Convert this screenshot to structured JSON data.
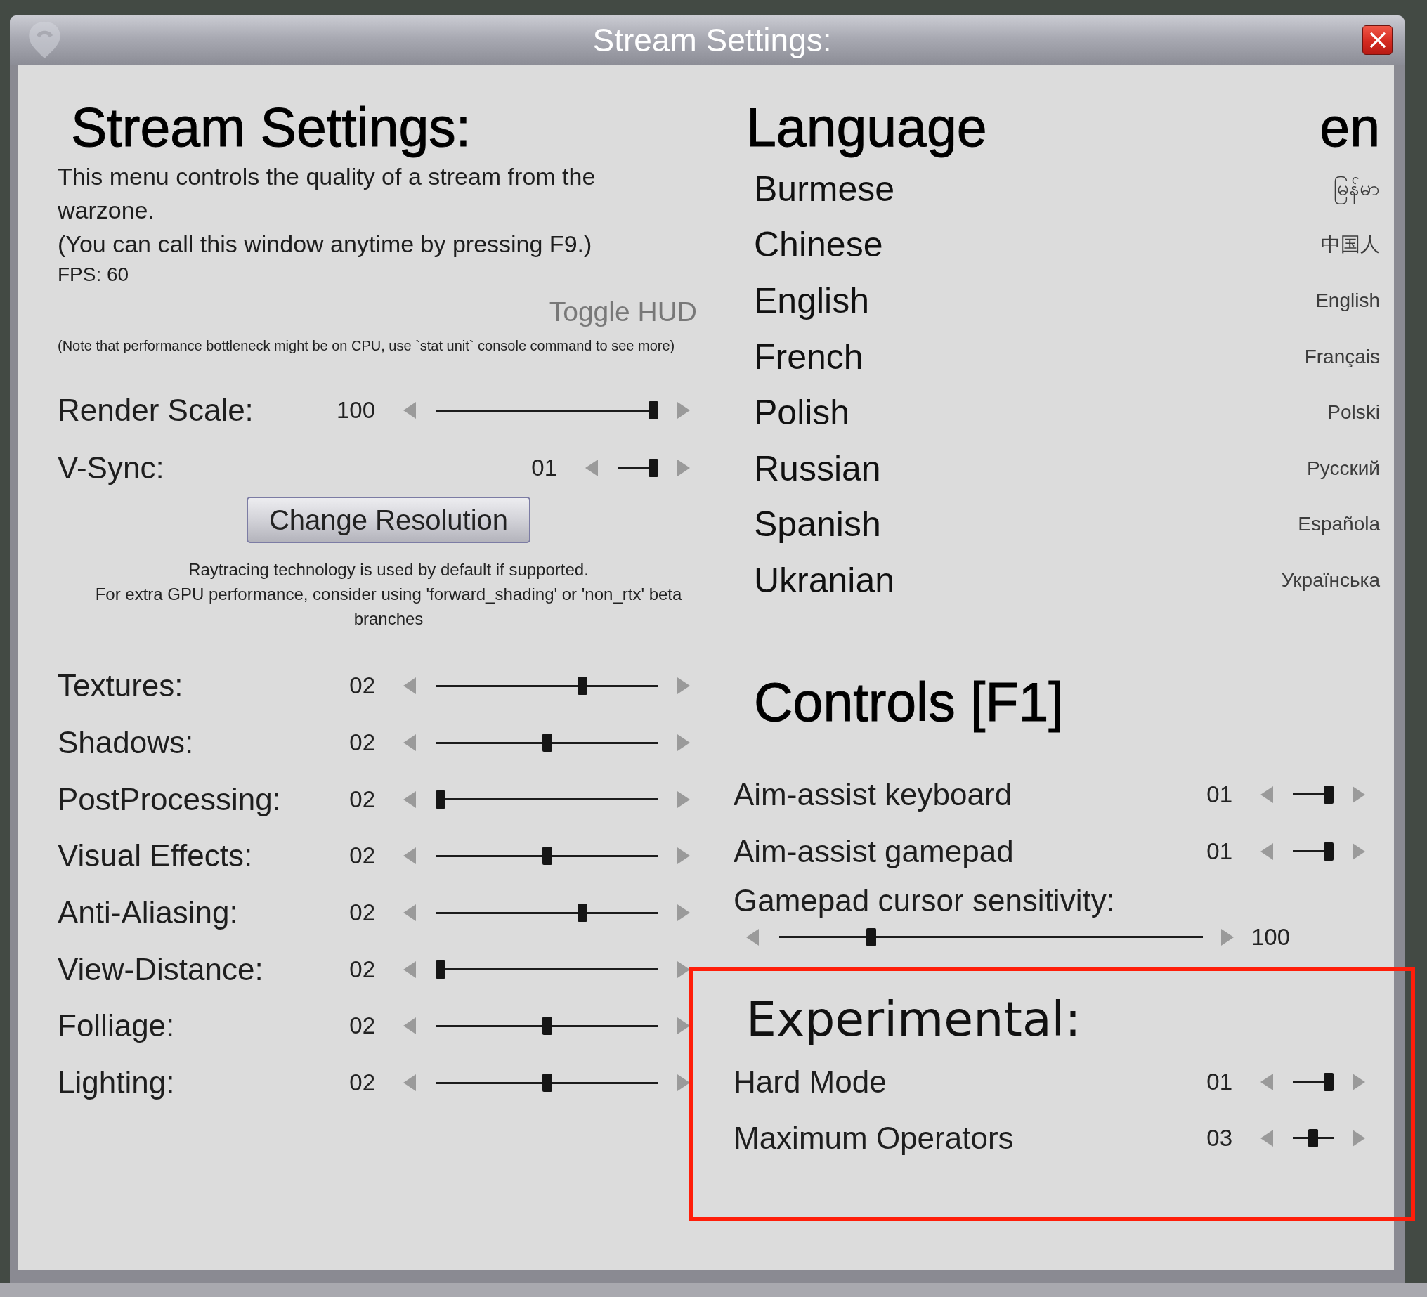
{
  "window": {
    "title": "Stream Settings:"
  },
  "stream_settings": {
    "heading": "Stream Settings:",
    "description": "This menu controls the quality of a stream from the warzone.",
    "hint": "(You can call this window anytime by pressing F9.)",
    "fps": "FPS: 60",
    "toggle_hud": "Toggle HUD",
    "note": "(Note that performance bottleneck might be on CPU, use `stat unit` console command to see more)",
    "display": [
      {
        "label": "Render Scale:",
        "value": "100",
        "kind": "long",
        "level": 1
      },
      {
        "label": "V-Sync:",
        "value": "01",
        "kind": "short",
        "level": 1
      }
    ],
    "change_resolution": "Change Resolution",
    "raytracing_note": "Raytracing technology is used by default if supported.\nFor extra GPU performance, consider using 'forward_shading' or 'non_rtx' beta branches",
    "quality": [
      {
        "label": "Textures:",
        "value": "02",
        "level": 0.667
      },
      {
        "label": "Shadows:",
        "value": "02",
        "level": 0.5
      },
      {
        "label": "PostProcessing:",
        "value": "02",
        "level": 0
      },
      {
        "label": "Visual Effects:",
        "value": "02",
        "level": 0.5
      },
      {
        "label": "Anti-Aliasing:",
        "value": "02",
        "level": 0.667
      },
      {
        "label": "View-Distance:",
        "value": "02",
        "level": 0
      },
      {
        "label": "Folliage:",
        "value": "02",
        "level": 0.5
      },
      {
        "label": "Lighting:",
        "value": "02",
        "level": 0.5
      }
    ]
  },
  "language": {
    "heading": "Language",
    "current": "en",
    "options": [
      {
        "name": "Burmese",
        "native": "မြန်မာ"
      },
      {
        "name": "Chinese",
        "native": "中国人"
      },
      {
        "name": "English",
        "native": "English"
      },
      {
        "name": "French",
        "native": "Français"
      },
      {
        "name": "Polish",
        "native": "Polski"
      },
      {
        "name": "Russian",
        "native": "Русский"
      },
      {
        "name": "Spanish",
        "native": "Española"
      },
      {
        "name": "Ukranian",
        "native": "Українська"
      }
    ]
  },
  "controls": {
    "heading": "Controls [F1]",
    "settings": [
      {
        "label": "Aim-assist keyboard",
        "value": "01",
        "level": 1
      },
      {
        "label": "Aim-assist gamepad",
        "value": "01",
        "level": 1
      }
    ],
    "cursor_sensitivity": {
      "label": "Gamepad cursor sensitivity:",
      "value": "100",
      "level": 0.21
    }
  },
  "experimental": {
    "heading": "Experimental:",
    "settings": [
      {
        "label": "Hard Mode",
        "value": "01",
        "level": 1
      },
      {
        "label": "Maximum Operators",
        "value": "03",
        "level": 0.5
      }
    ]
  }
}
